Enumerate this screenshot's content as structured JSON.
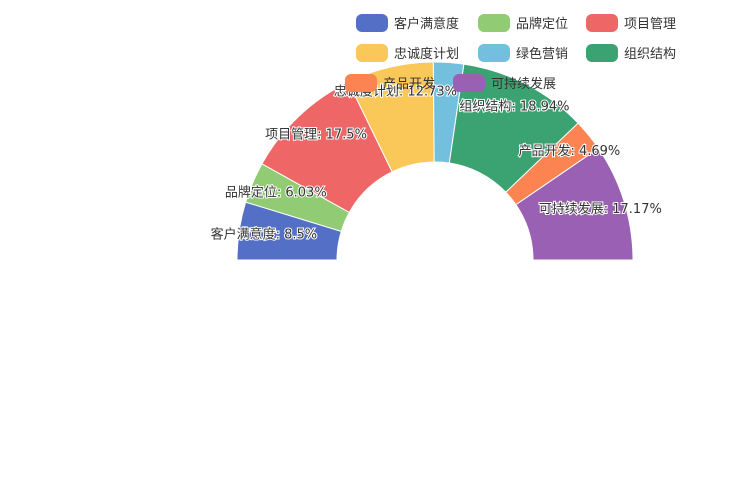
{
  "chart_data": {
    "type": "pie",
    "subtype": "half-donut",
    "legend_position": "top-right",
    "slices": [
      {
        "name": "客户满意度",
        "value": 8.5,
        "label": "客户满意度: 8.5%",
        "color": "#5470c6"
      },
      {
        "name": "品牌定位",
        "value": 6.03,
        "label": "品牌定位: 6.03%",
        "color": "#91cc75"
      },
      {
        "name": "项目管理",
        "value": 17.5,
        "label": "项目管理: 17.5%",
        "color": "#ee6666"
      },
      {
        "name": "忠诚度计划",
        "value": 12.73,
        "label": "忠诚度计划: 12.73%",
        "color": "#fac858"
      },
      {
        "name": "绿色营销",
        "value": 4.44,
        "label": "",
        "color": "#73c0de"
      },
      {
        "name": "组织结构",
        "value": 18.94,
        "label": "组织结构: 18.94%",
        "color": "#3ba272"
      },
      {
        "name": "产品开发",
        "value": 4.69,
        "label": "产品开发: 4.69%",
        "color": "#fc8452"
      },
      {
        "name": "可持续发展",
        "value": 17.17,
        "label": "可持续发展: 17.17%",
        "color": "#9a60b4"
      }
    ]
  }
}
